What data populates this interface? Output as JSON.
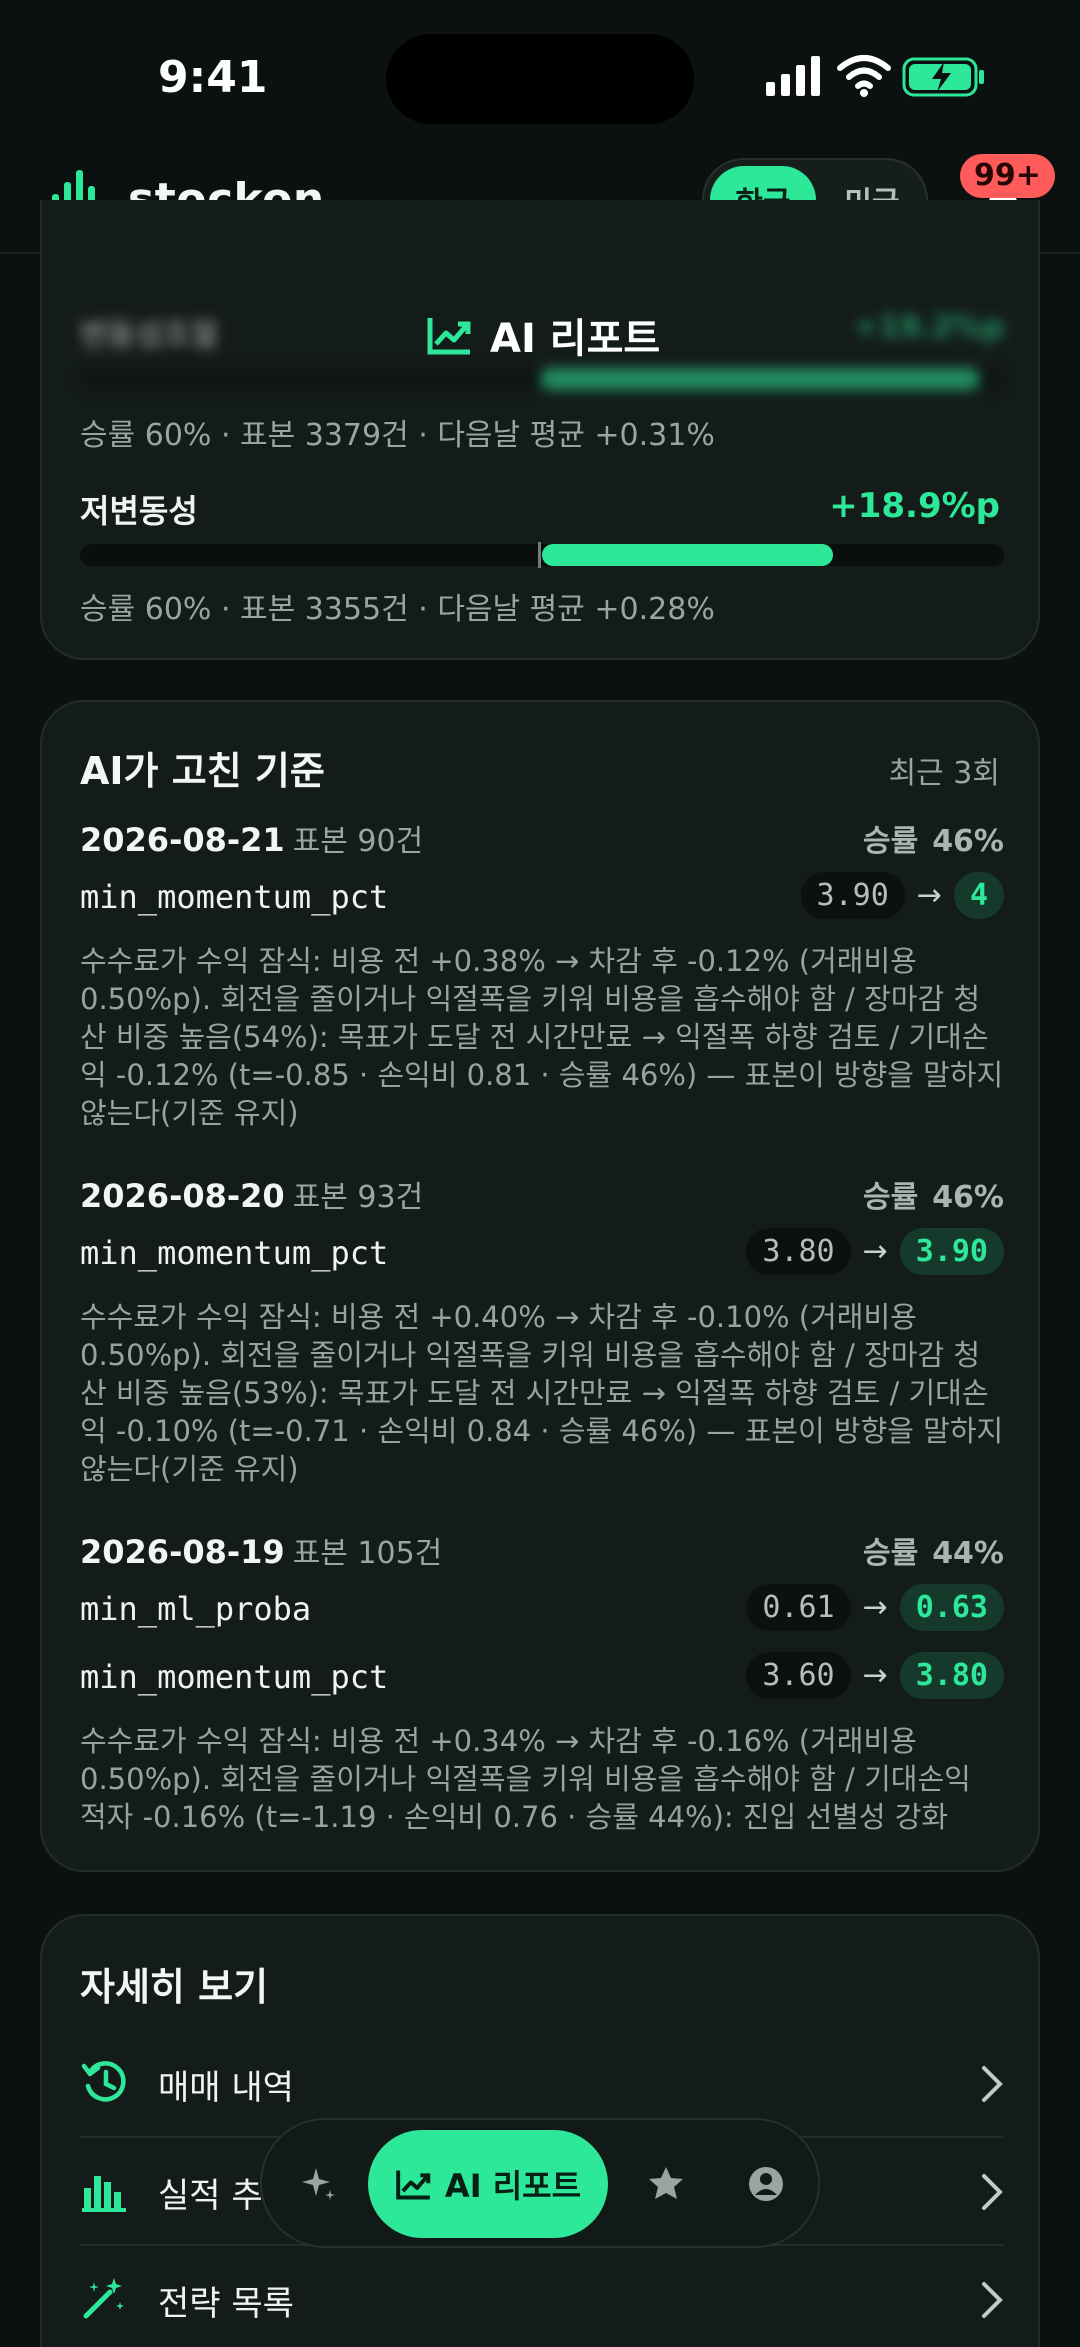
{
  "status_bar": {
    "time": "9:41"
  },
  "header": {
    "brand": "stockon",
    "market_tabs": [
      "한국",
      "미국"
    ],
    "notification_badge": "99+"
  },
  "ai_report_title": "AI 리포트",
  "regime_card": {
    "blurred_row": {
      "label": "변동성조절",
      "value": "+19.2%p",
      "fill": 0.32
    },
    "rows": [
      {
        "stat": "승률 60% · 표본 3379건 · 다음날 평균 +0.31%"
      },
      {
        "label": "저변동성",
        "value": "+18.9%p",
        "stat": "승률 60% · 표본 3355건 · 다음날 평균 +0.28%",
        "fill": 0.315
      }
    ]
  },
  "criteria_card": {
    "title": "AI가 고친 기준",
    "meta": "최근 3회",
    "entries": [
      {
        "date": "2026-08-21",
        "sample": "표본 90건",
        "win_label": "승률",
        "win_value": "46%",
        "params": [
          {
            "name": "min_momentum_pct",
            "old": "3.90",
            "new": "4"
          }
        ],
        "desc": "수수료가 수익 잠식: 비용 전 +0.38% → 차감 후 -0.12% (거래비용 0.50%p). 회전을 줄이거나 익절폭을 키워 비용을 흡수해야 함 / 장마감 청산 비중 높음(54%): 목표가 도달 전 시간만료 → 익절폭 하향 검토 / 기대손익 -0.12% (t=-0.85 · 손익비 0.81 · 승률 46%) — 표본이 방향을 말하지 않는다(기준 유지)"
      },
      {
        "date": "2026-08-20",
        "sample": "표본 93건",
        "win_label": "승률",
        "win_value": "46%",
        "params": [
          {
            "name": "min_momentum_pct",
            "old": "3.80",
            "new": "3.90"
          }
        ],
        "desc": "수수료가 수익 잠식: 비용 전 +0.40% → 차감 후 -0.10% (거래비용 0.50%p). 회전을 줄이거나 익절폭을 키워 비용을 흡수해야 함 / 장마감 청산 비중 높음(53%): 목표가 도달 전 시간만료 → 익절폭 하향 검토 / 기대손익 -0.10% (t=-0.71 · 손익비 0.84 · 승률 46%) — 표본이 방향을 말하지 않는다(기준 유지)"
      },
      {
        "date": "2026-08-19",
        "sample": "표본 105건",
        "win_label": "승률",
        "win_value": "44%",
        "params": [
          {
            "name": "min_ml_proba",
            "old": "0.61",
            "new": "0.63"
          },
          {
            "name": "min_momentum_pct",
            "old": "3.60",
            "new": "3.80"
          }
        ],
        "desc": "수수료가 수익 잠식: 비용 전 +0.34% → 차감 후 -0.16% (거래비용 0.50%p). 회전을 줄이거나 익절폭을 키워 비용을 흡수해야 함 / 기대손익 적자 -0.16% (t=-1.19 · 손익비 0.76 · 승률 44%): 진입 선별성 강화"
      }
    ]
  },
  "details_card": {
    "title": "자세히 보기",
    "items": [
      {
        "label": "매매 내역",
        "icon": "history-icon"
      },
      {
        "label": "실적 추",
        "icon": "bar-chart-icon"
      },
      {
        "label": "전략 목록",
        "icon": "magic-wand-icon"
      }
    ]
  },
  "bottom_nav": {
    "active_label": "AI 리포트",
    "items": [
      "sparkle-icon",
      "chart-icon",
      "star-icon",
      "user-icon"
    ]
  },
  "colors": {
    "accent": "#2ee89a",
    "badge": "#ff5b5b",
    "background": "#0b1110",
    "card": "#141c1a"
  }
}
